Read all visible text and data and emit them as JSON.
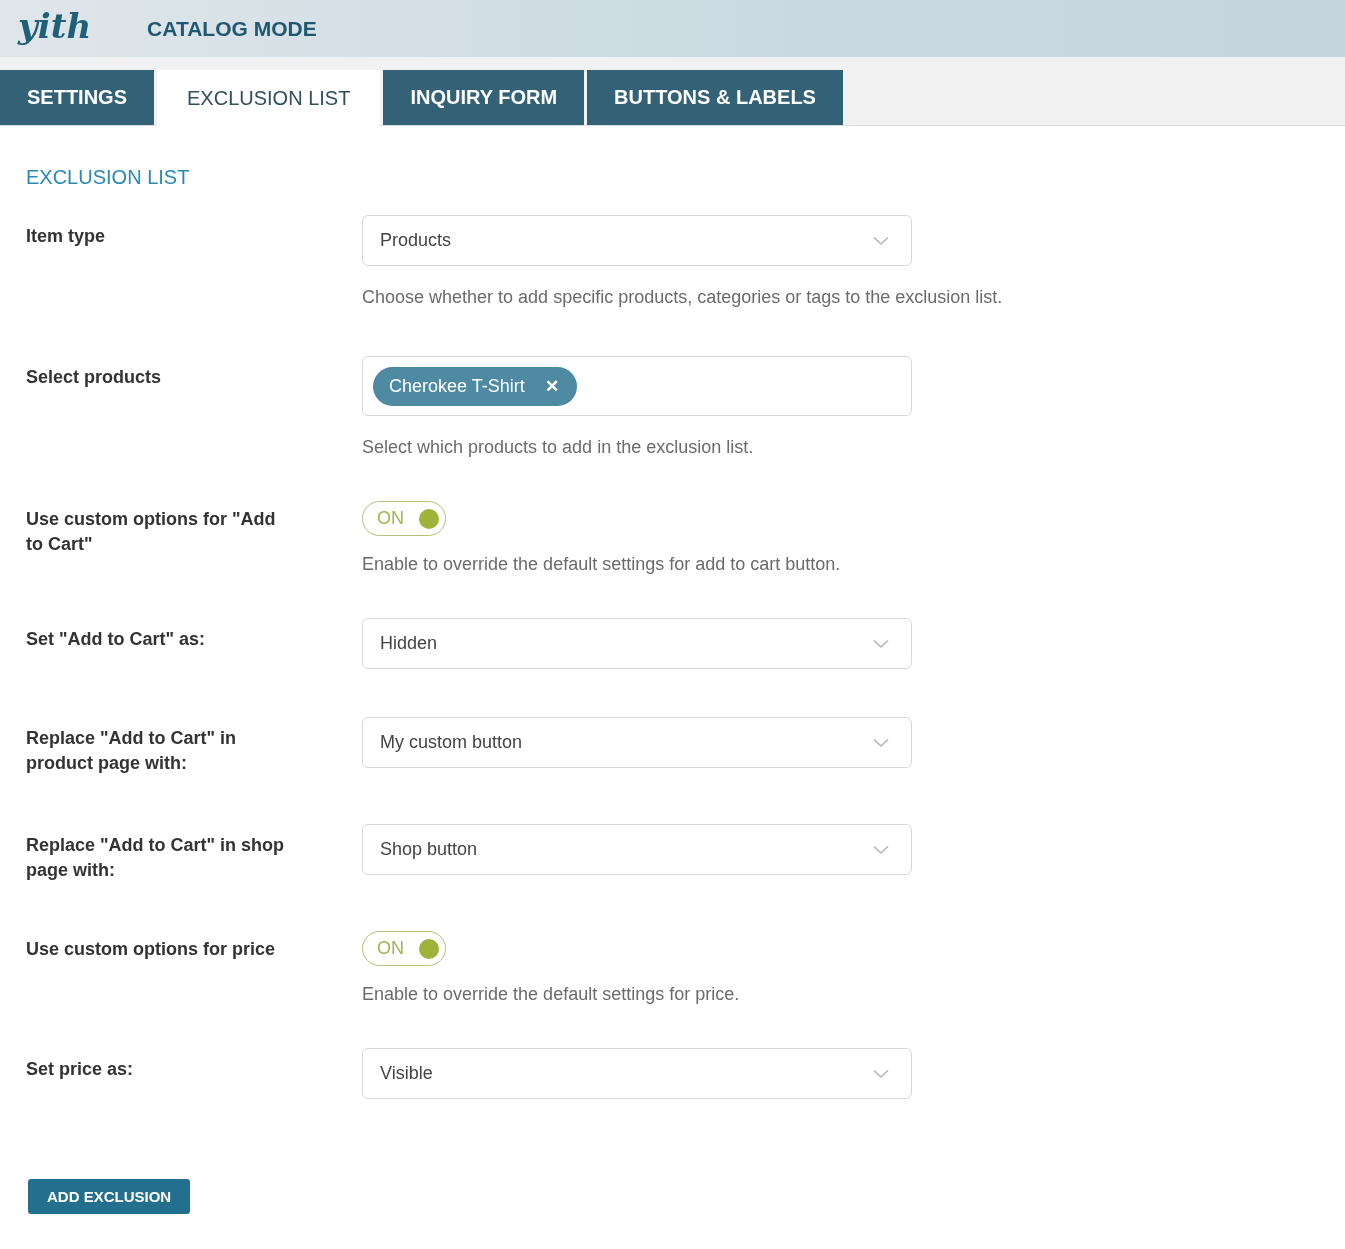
{
  "header": {
    "logo": "yith",
    "title": "CATALOG MODE"
  },
  "tabs": [
    {
      "label": "SETTINGS",
      "selected": false
    },
    {
      "label": "EXCLUSION LIST",
      "selected": true
    },
    {
      "label": "INQUIRY FORM",
      "selected": false
    },
    {
      "label": "BUTTONS & LABELS",
      "selected": false
    }
  ],
  "section_title": "EXCLUSION LIST",
  "fields": [
    {
      "kind": "select",
      "label": "Item type",
      "value": "Products",
      "description": "Choose whether to add specific products, categories or tags to the exclusion list."
    },
    {
      "kind": "tags",
      "label": "Select products",
      "tags": [
        "Cherokee T-Shirt"
      ],
      "remove_symbol": "✕",
      "description": "Select which products to add in the exclusion list."
    },
    {
      "kind": "toggle",
      "label": "Use custom options for \"Add to Cart\"",
      "on": true,
      "toggle_text": "ON",
      "description": "Enable to override the default settings for add to cart button."
    },
    {
      "kind": "select",
      "label": "Set \"Add to Cart\" as:",
      "value": "Hidden"
    },
    {
      "kind": "select",
      "label": "Replace \"Add to Cart\" in product page with:",
      "value": "My custom button"
    },
    {
      "kind": "select",
      "label": "Replace \"Add to Cart\" in shop page with:",
      "value": "Shop button"
    },
    {
      "kind": "toggle",
      "label": "Use custom options for price",
      "on": true,
      "toggle_text": "ON",
      "description": "Enable to override the default settings for price."
    },
    {
      "kind": "select",
      "label": "Set price as:",
      "value": "Visible"
    }
  ],
  "submit_button": "ADD EXCLUSION"
}
